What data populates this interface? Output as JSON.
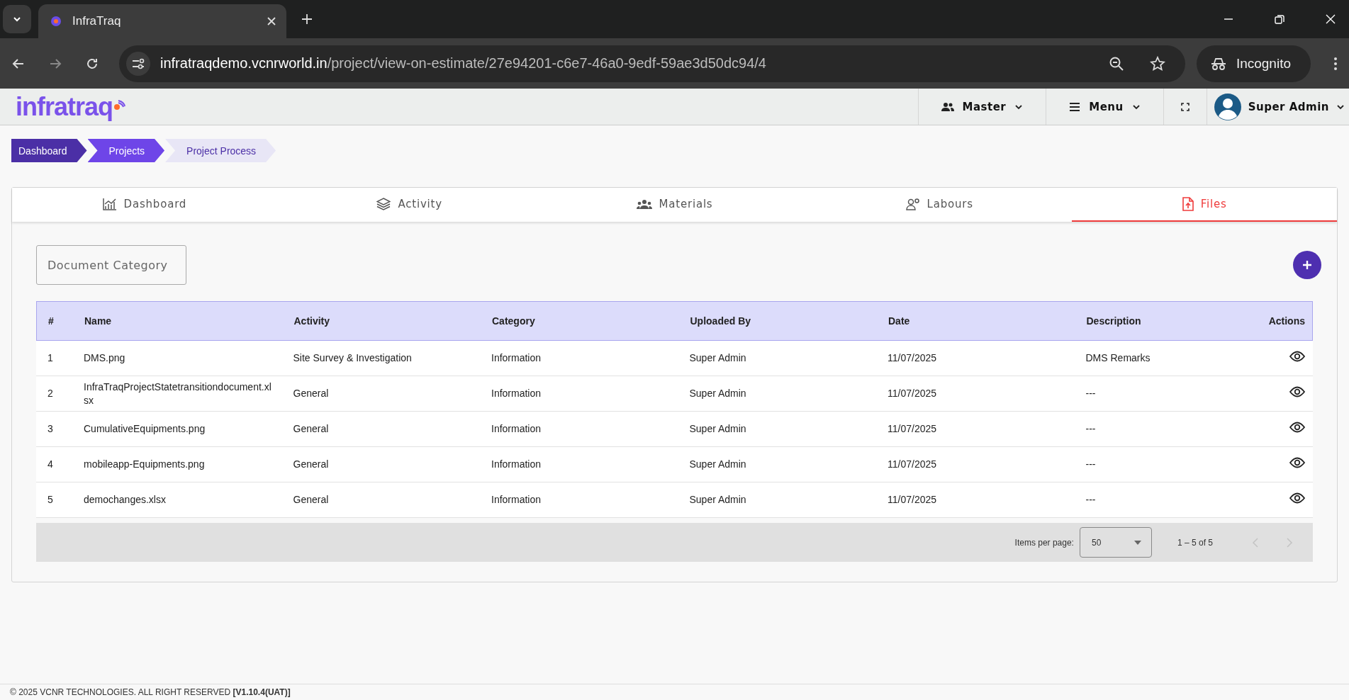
{
  "browser": {
    "tab_title": "InfraTraq",
    "url_host": "infratraqdemo.vcnrworld.in",
    "url_path": "/project/view-on-estimate/27e94201-c6e7-46a0-9edf-59ae3d50dc94/4",
    "profile_label": "Incognito"
  },
  "header": {
    "logo": "infratraq",
    "nav": [
      {
        "label": "Master"
      },
      {
        "label": "Menu"
      }
    ],
    "user": "Super Admin"
  },
  "breadcrumb": [
    {
      "label": "Dashboard",
      "kind": "dark"
    },
    {
      "label": "Projects",
      "kind": "mid"
    },
    {
      "label": "Project Process",
      "kind": "light"
    }
  ],
  "tabs": [
    {
      "label": "Dashboard",
      "selected": false
    },
    {
      "label": "Activity",
      "selected": false
    },
    {
      "label": "Materials",
      "selected": false
    },
    {
      "label": "Labours",
      "selected": false
    },
    {
      "label": "Files",
      "selected": true
    }
  ],
  "filter": {
    "placeholder": "Document Category"
  },
  "table": {
    "columns": [
      "#",
      "Name",
      "Activity",
      "Category",
      "Uploaded By",
      "Date",
      "Description",
      "Actions"
    ],
    "rows": [
      [
        "1",
        "DMS.png",
        "Site Survey & Investigation",
        "Information",
        "Super Admin",
        "11/07/2025",
        "DMS Remarks"
      ],
      [
        "2",
        "InfraTraqProjectStatetransitiondocument.xlsx",
        "General",
        "Information",
        "Super Admin",
        "11/07/2025",
        "---"
      ],
      [
        "3",
        "CumulativeEquipments.png",
        "General",
        "Information",
        "Super Admin",
        "11/07/2025",
        "---"
      ],
      [
        "4",
        "mobileapp-Equipments.png",
        "General",
        "Information",
        "Super Admin",
        "11/07/2025",
        "---"
      ],
      [
        "5",
        "demochanges.xlsx",
        "General",
        "Information",
        "Super Admin",
        "11/07/2025",
        "---"
      ]
    ]
  },
  "pagination": {
    "items_per_page_label": "Items per page:",
    "page_size": "50",
    "range": "1 – 5 of 5"
  },
  "footer": "© 2025 VCNR TECHNOLOGIES. ALL RIGHT RESERVED **[V1.10.4(UAT)]**"
}
